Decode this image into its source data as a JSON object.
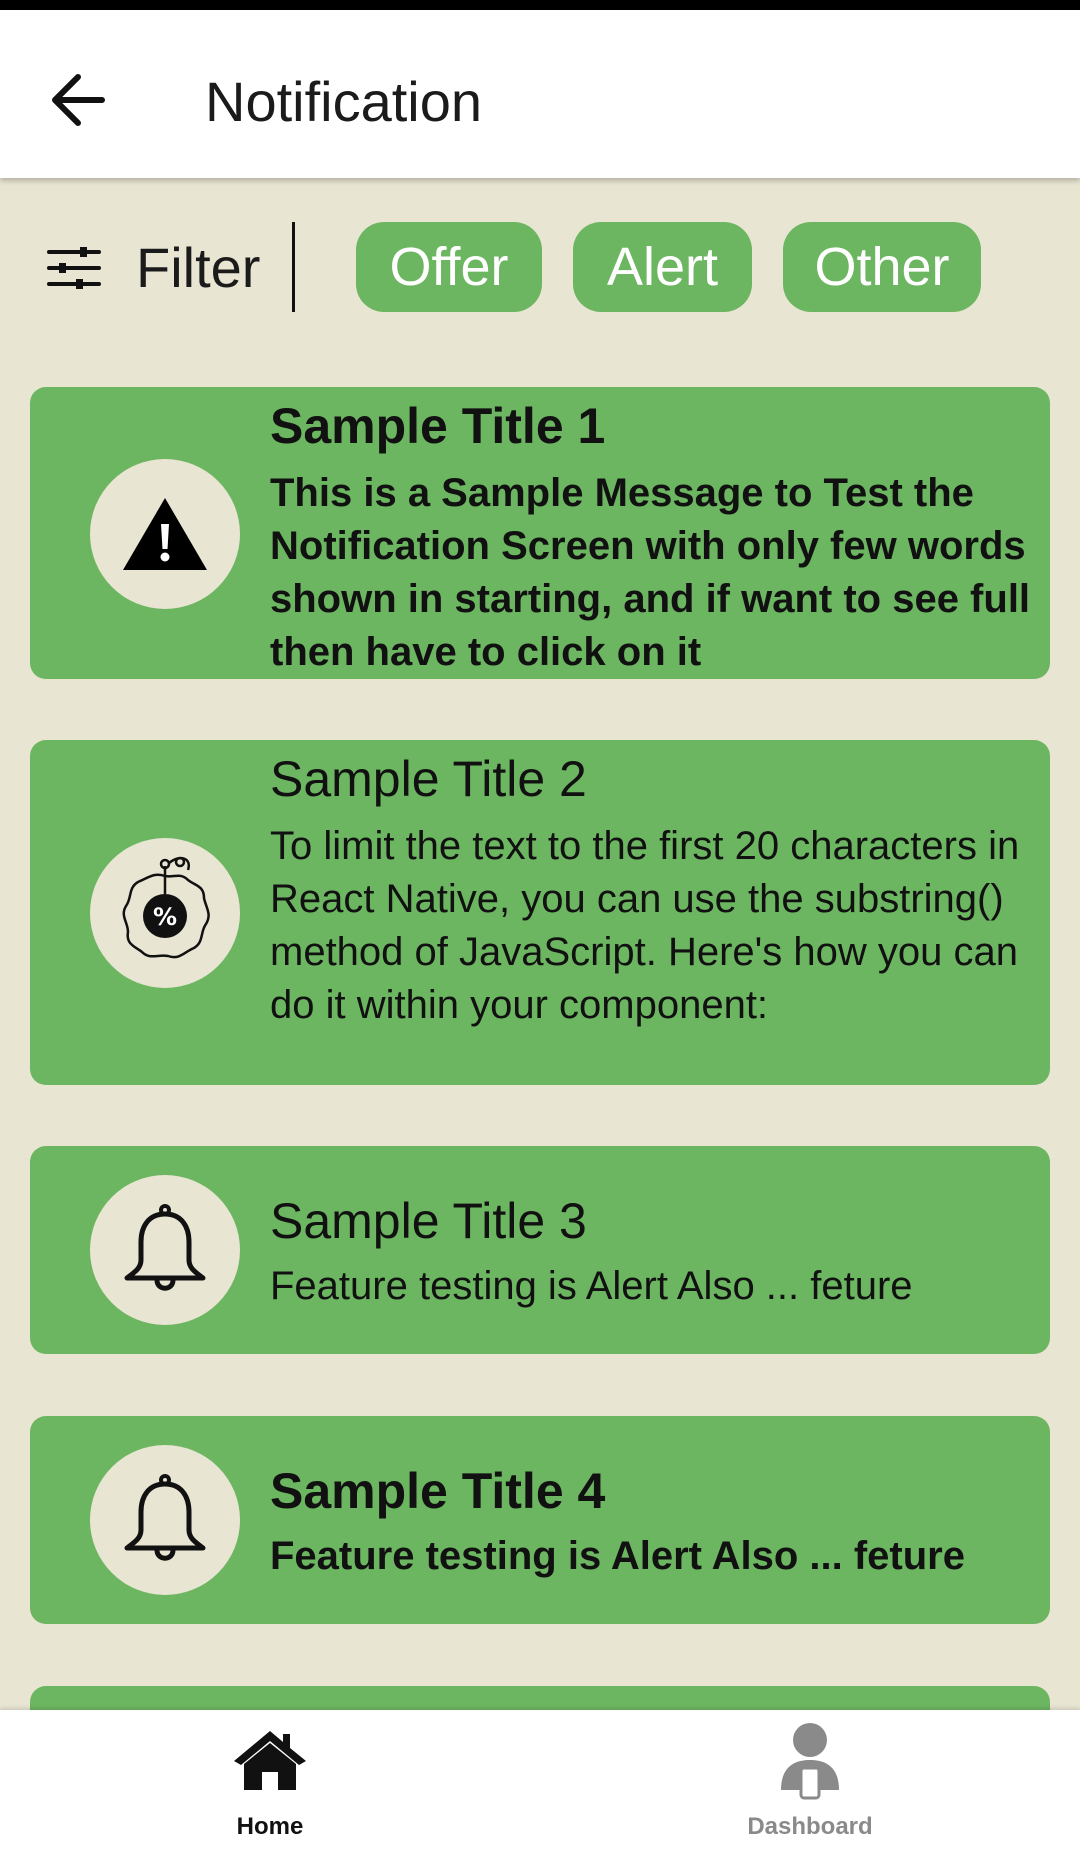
{
  "header": {
    "title": "Notification",
    "back_icon": "arrow-left-icon"
  },
  "filter": {
    "label": "Filter",
    "icon": "sliders-icon",
    "chips": [
      "Offer",
      "Alert",
      "Other"
    ]
  },
  "notifications": [
    {
      "title": "Sample Title 1",
      "message": "This is a Sample Message to Test the Notification Screen with only few words shown in starting, and if want to see full then have to click on it",
      "icon": "warning-icon",
      "unread": true
    },
    {
      "title": "Sample Title 2",
      "message": "To limit the text to the first 20 characters in React Native, you can use the substring() method of JavaScript. Here's how you can do it within your component:",
      "icon": "discount-tag-icon",
      "unread": false
    },
    {
      "title": "Sample Title 3",
      "message": "Feature testing is Alert Also ... feture",
      "icon": "bell-icon",
      "unread": false
    },
    {
      "title": "Sample Title 4",
      "message": "Feature testing is Alert Also ... feture",
      "icon": "bell-icon",
      "unread": true
    }
  ],
  "bottom_nav": {
    "items": [
      {
        "label": "Home",
        "icon": "home-icon",
        "active": true
      },
      {
        "label": "Dashboard",
        "icon": "user-device-icon",
        "active": false
      }
    ]
  },
  "colors": {
    "background": "#e9e5d3",
    "card": "#6db661",
    "chip": "#6db661",
    "active_nav": "#111111",
    "inactive_nav": "#8a8a8a"
  }
}
